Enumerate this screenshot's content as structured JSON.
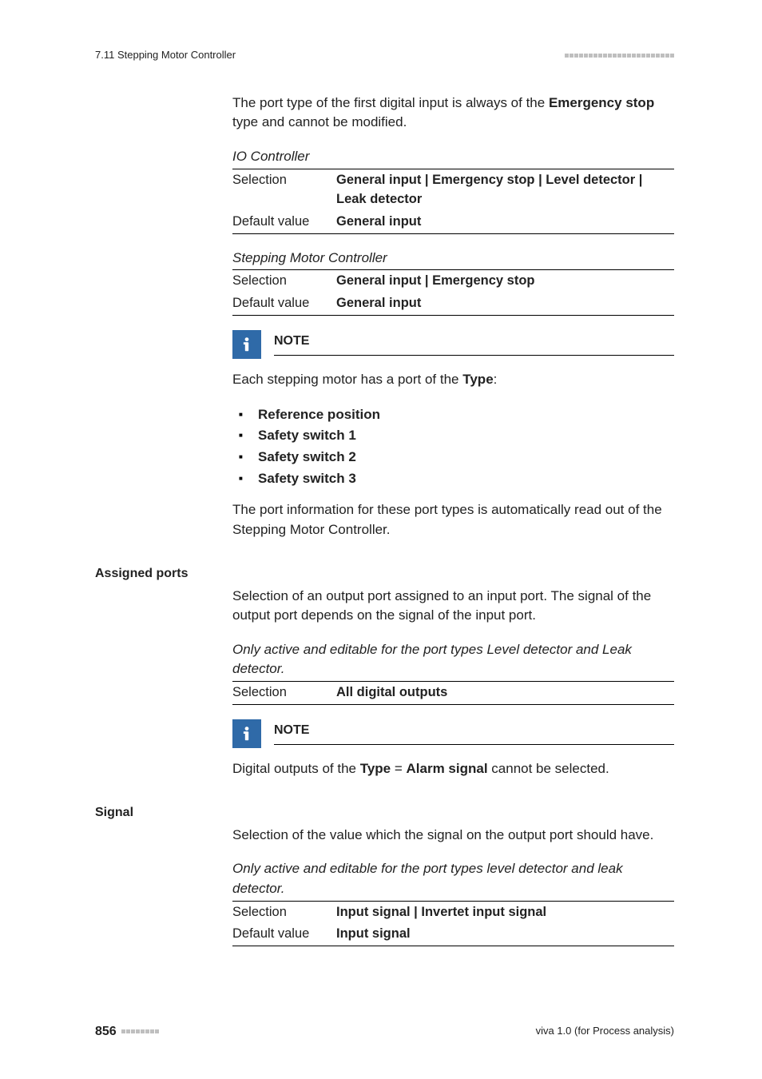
{
  "header": {
    "section": "7.11 Stepping Motor Controller"
  },
  "intro": {
    "text_before_bold": "The port type of the first digital input is always of the ",
    "bold": "Emergency stop",
    "text_after_bold": " type and cannot be modified."
  },
  "io_controller": {
    "caption": "IO Controller",
    "rows": {
      "selection_label": "Selection",
      "selection_value": "General input | Emergency stop | Level detector | Leak detector",
      "default_label": "Default value",
      "default_value": "General input"
    }
  },
  "smc": {
    "caption": "Stepping Motor Controller",
    "rows": {
      "selection_label": "Selection",
      "selection_value": "General input | Emergency stop",
      "default_label": "Default value",
      "default_value": "General input"
    }
  },
  "note1": {
    "title": "NOTE",
    "lead_before": "Each stepping motor has a port of the ",
    "lead_bold": "Type",
    "lead_after": ":",
    "items": [
      "Reference position",
      "Safety switch 1",
      "Safety switch 2",
      "Safety switch 3"
    ],
    "trail": "The port information for these port types is automatically read out of the Stepping Motor Controller."
  },
  "assigned_ports": {
    "heading": "Assigned ports",
    "desc": "Selection of an output port assigned to an input port. The signal of the output port depends on the signal of the input port.",
    "cond_italic": "Only active and editable for the port types Level detector and Leak detector.",
    "sel_label": "Selection",
    "sel_value": "All digital outputs"
  },
  "note2": {
    "title": "NOTE",
    "body_before": "Digital outputs of the ",
    "body_bold1": "Type",
    "body_eq": " = ",
    "body_bold2": "Alarm signal",
    "body_after": " cannot be selected."
  },
  "signal_section": {
    "heading": "Signal",
    "desc": "Selection of the value which the signal on the output port should have.",
    "cond_italic": "Only active and editable for the port types level detector and leak detector.",
    "sel_label": "Selection",
    "sel_value": "Input signal | Invertet input signal",
    "def_label": "Default value",
    "def_value": "Input signal"
  },
  "footer": {
    "page": "856",
    "right": "viva 1.0 (for Process analysis)"
  }
}
